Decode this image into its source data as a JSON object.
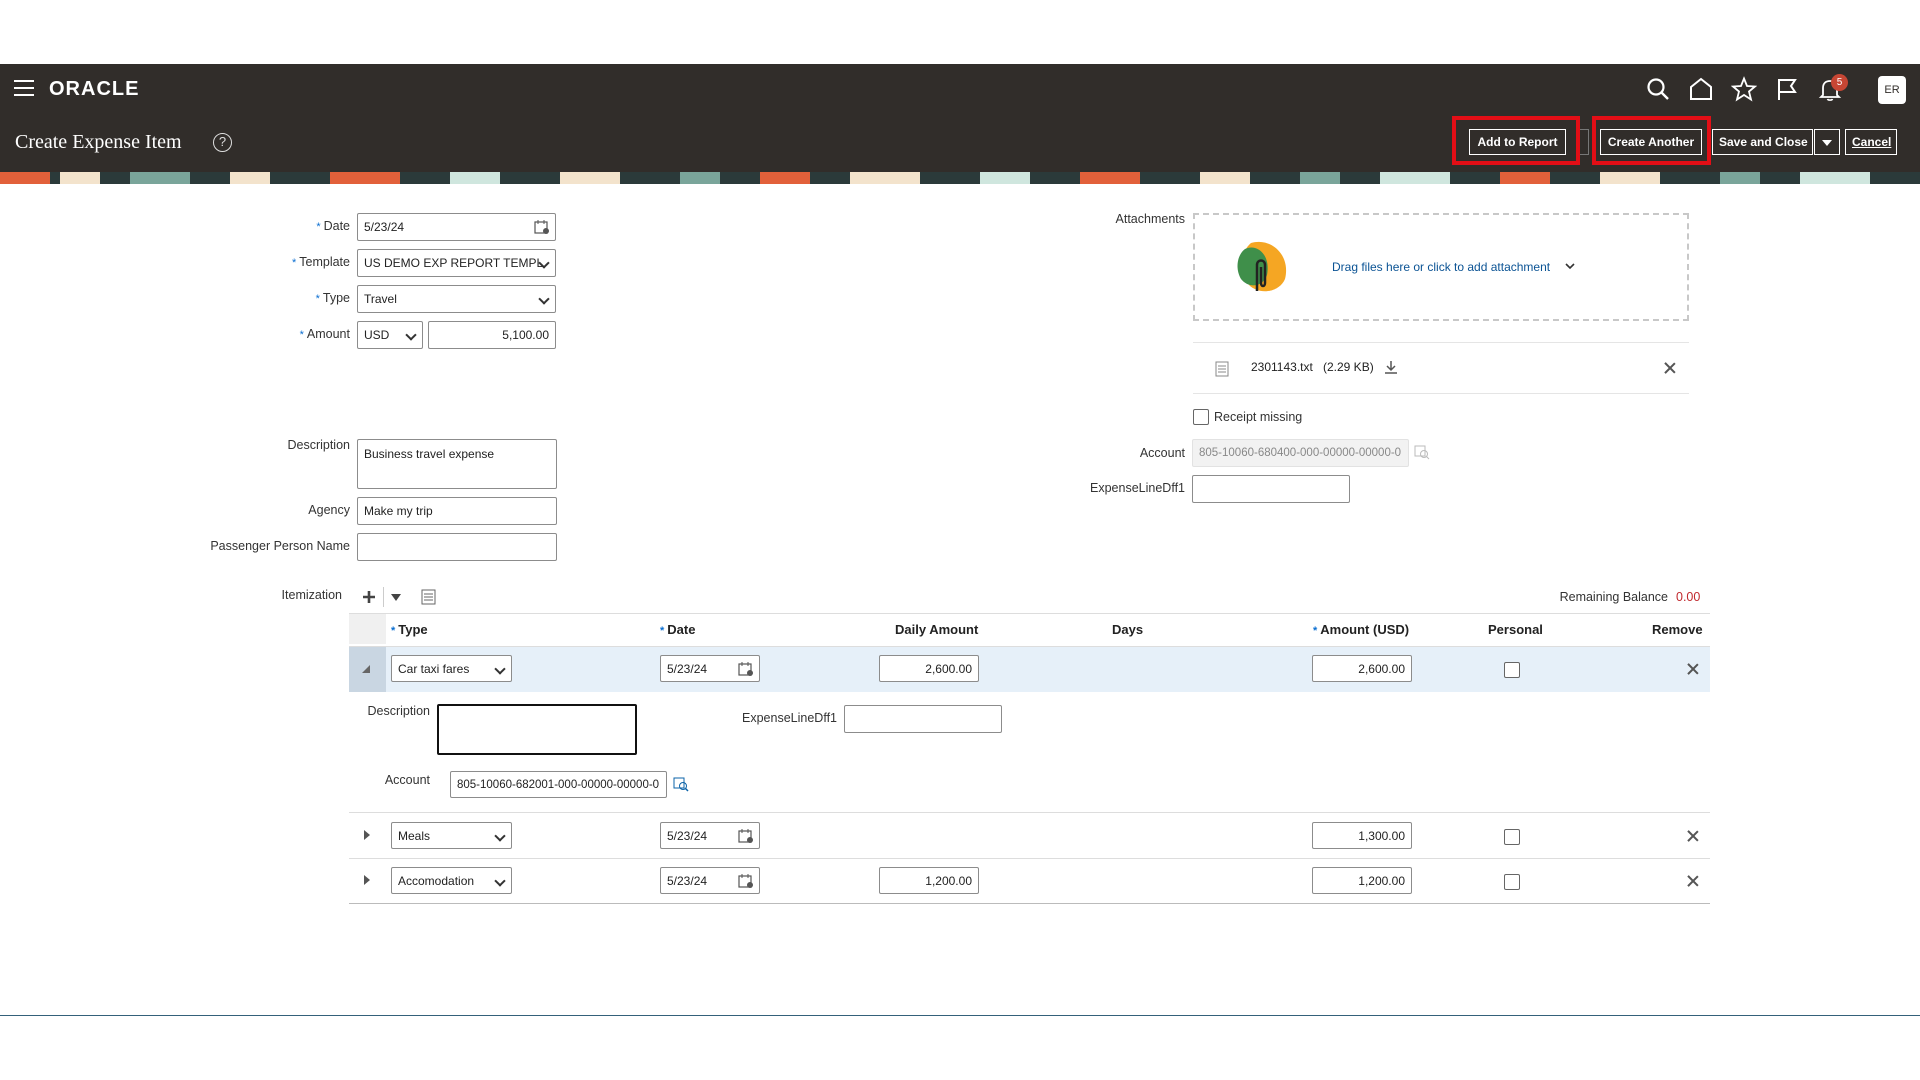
{
  "global": {
    "logo": "ORACLE",
    "notification_count": "5",
    "avatar_initials": "ER"
  },
  "page": {
    "title": "Create Expense Item",
    "buttons": {
      "add_to_report": "Add to Report",
      "create_another": "Create Another",
      "save_and_close": "Save and Close",
      "cancel": "Cancel"
    }
  },
  "form": {
    "date_label": "Date",
    "date_value": "5/23/24",
    "template_label": "Template",
    "template_value": "US DEMO EXP REPORT TEMPL",
    "type_label": "Type",
    "type_value": "Travel",
    "amount_label": "Amount",
    "currency_value": "USD",
    "amount_value": "5,100.00",
    "description_label": "Description",
    "description_value": "Business travel expense",
    "agency_label": "Agency",
    "agency_value": "Make my trip",
    "passenger_label": "Passenger Person Name",
    "passenger_value": ""
  },
  "right": {
    "attachments_label": "Attachments",
    "drop_text": "Drag files here or click to add attachment",
    "file_name": "2301143.txt",
    "file_size": "(2.29 KB)",
    "receipt_missing_label": "Receipt missing",
    "account_label": "Account",
    "account_value": "805-10060-680400-000-00000-00000-0",
    "dff_label": "ExpenseLineDff1",
    "dff_value": ""
  },
  "itemization": {
    "label": "Itemization",
    "remaining_balance_label": "Remaining Balance",
    "remaining_balance_value": "0.00",
    "columns": {
      "type": "Type",
      "date": "Date",
      "daily_amount": "Daily Amount",
      "days": "Days",
      "amount_usd": "Amount (USD)",
      "personal": "Personal",
      "remove": "Remove"
    },
    "rows": [
      {
        "type": "Car taxi fares",
        "date": "5/23/24",
        "daily_amount": "2,600.00",
        "amount": "2,600.00"
      },
      {
        "type": "Meals",
        "date": "5/23/24",
        "daily_amount": "",
        "amount": "1,300.00"
      },
      {
        "type": "Accomodation",
        "date": "5/23/24",
        "daily_amount": "1,200.00",
        "amount": "1,200.00"
      }
    ],
    "detail": {
      "description_label": "Description",
      "description_value": "",
      "dff_label": "ExpenseLineDff1",
      "dff_value": "",
      "account_label": "Account",
      "account_value": "805-10060-682001-000-00000-00000-0"
    }
  }
}
